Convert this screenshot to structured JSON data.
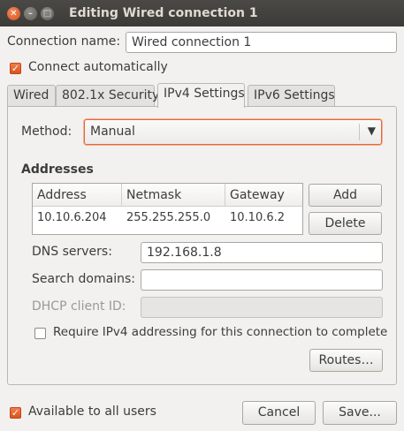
{
  "window": {
    "title": "Editing Wired connection 1"
  },
  "connection_name": {
    "label": "Connection name:",
    "value": "Wired connection 1"
  },
  "connect_automatically": {
    "label": "Connect automatically",
    "checked": true
  },
  "tabs": [
    {
      "label": "Wired"
    },
    {
      "label": "802.1x Security"
    },
    {
      "label": "IPv4 Settings"
    },
    {
      "label": "IPv6 Settings"
    }
  ],
  "method": {
    "label": "Method:",
    "value": "Manual"
  },
  "addresses": {
    "heading": "Addresses",
    "columns": [
      "Address",
      "Netmask",
      "Gateway"
    ],
    "rows": [
      [
        "10.10.6.204",
        "255.255.255.0",
        "10.10.6.2"
      ]
    ],
    "add_label": "Add",
    "delete_label": "Delete"
  },
  "dns_servers": {
    "label": "DNS servers:",
    "value": "192.168.1.8"
  },
  "search_domains": {
    "label": "Search domains:",
    "value": ""
  },
  "dhcp_client_id": {
    "label": "DHCP client ID:",
    "value": ""
  },
  "require_ipv4": {
    "label": "Require IPv4 addressing for this connection to complete",
    "checked": false
  },
  "routes_label": "Routes…",
  "available_to_all_users": {
    "label": "Available to all users",
    "checked": true
  },
  "footer": {
    "cancel_label": "Cancel",
    "save_label": "Save..."
  },
  "colors": {
    "accent": "#dd4814",
    "titlebar": "#3c3b37",
    "window_bg": "#f2f1f0"
  }
}
